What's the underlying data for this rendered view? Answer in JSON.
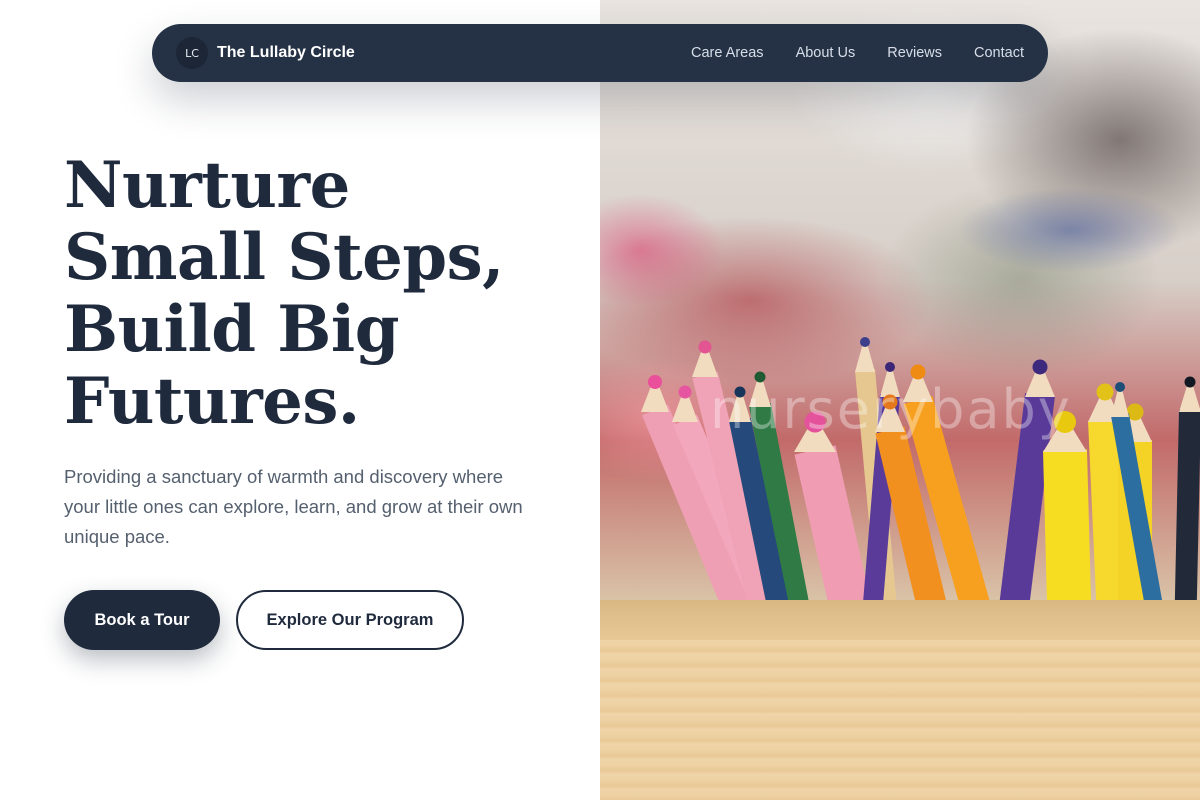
{
  "nav": {
    "logo_initials": "LC",
    "brand": "The Lullaby Circle",
    "links": [
      "Care Areas",
      "About Us",
      "Reviews",
      "Contact"
    ]
  },
  "hero": {
    "headline_lines": [
      "Nurture",
      "Small Steps,",
      "Build Big",
      "Futures."
    ],
    "subtitle": "Providing a sanctuary of warmth and discovery where your little ones can explore, learn, and grow at their own unique pace.",
    "primary_button": "Book a Tour",
    "secondary_button": "Explore Our Program"
  },
  "image": {
    "watermark": "nurserybaby",
    "subject": "colored-pencils-in-wooden-box"
  },
  "colors": {
    "navy": "#1f2a3d",
    "nav_bg": "#253246",
    "body_text": "#55606f"
  }
}
